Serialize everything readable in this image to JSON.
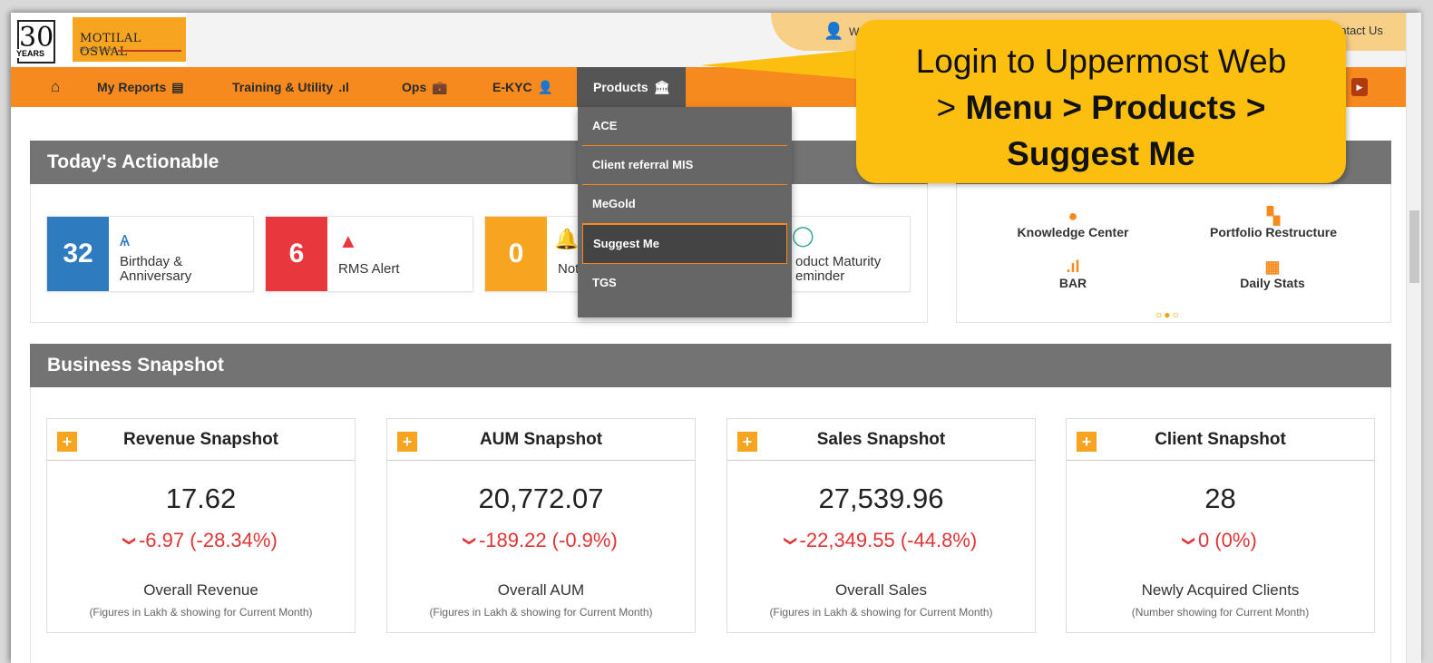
{
  "header": {
    "logo_years": "30",
    "logo_years_label": "YEARS",
    "brand_name": "MOTILAL OSWAL",
    "brand_sub": "Financial Services",
    "welcome": "W",
    "contact": "ontact Us"
  },
  "nav": {
    "home_icon": "home-icon",
    "items": [
      {
        "label": "My Reports",
        "icon": "report-icon",
        "glyph": "▤"
      },
      {
        "label": "Training & Utility",
        "icon": "bar-chart-icon",
        "glyph": ".ıl"
      },
      {
        "label": "Ops",
        "icon": "briefcase-icon",
        "glyph": "💼"
      },
      {
        "label": "E-KYC",
        "icon": "user-icon",
        "glyph": "👤"
      },
      {
        "label": "Products",
        "icon": "bank-icon",
        "glyph": "🏛"
      }
    ]
  },
  "dropdown": {
    "items": [
      "ACE",
      "Client referral MIS",
      "MeGold",
      "Suggest Me",
      "TGS"
    ],
    "active": "Suggest Me"
  },
  "callout": {
    "line1": "Login to Uppermost Web",
    "line2_prefix": "> ",
    "line2_bold": "Menu > Products >",
    "line3": "Suggest Me"
  },
  "actionable": {
    "title": "Today's Actionable",
    "cards": [
      {
        "count": "32",
        "label1": "Birthday &",
        "label2": "Anniversary",
        "color": "#2f7bbf",
        "icon": "birthday-cake-icon"
      },
      {
        "count": "6",
        "label1": "RMS Alert",
        "label2": "",
        "color": "#e8383d",
        "icon": "warning-icon"
      },
      {
        "count": "0",
        "label1": "Not",
        "label2": "",
        "color": "#f7a521",
        "icon": "bell-icon"
      },
      {
        "count": "",
        "label1": "oduct Maturity",
        "label2": "eminder",
        "color": "#ffffff",
        "icon": "clock-icon"
      }
    ]
  },
  "tools": {
    "items": [
      "Knowledge Center",
      "Portfolio Restructure",
      "BAR",
      "Daily Stats"
    ],
    "dots": "○●○"
  },
  "business": {
    "title": "Business Snapshot",
    "snapshots": [
      {
        "title": "Revenue Snapshot",
        "value": "17.62",
        "change": "-6.97 (-28.34%)",
        "label": "Overall Revenue",
        "note": "(Figures in Lakh & showing for Current Month)"
      },
      {
        "title": "AUM Snapshot",
        "value": "20,772.07",
        "change": "-189.22 (-0.9%)",
        "label": "Overall AUM",
        "note": "(Figures in Lakh & showing for Current Month)"
      },
      {
        "title": "Sales Snapshot",
        "value": "27,539.96",
        "change": "-22,349.55 (-44.8%)",
        "label": "Overall Sales",
        "note": "(Figures in Lakh & showing for Current Month)"
      },
      {
        "title": "Client Snapshot",
        "value": "28",
        "change": "0 (0%)",
        "label": "Newly Acquired Clients",
        "note": "(Number showing for Current Month)"
      }
    ]
  }
}
